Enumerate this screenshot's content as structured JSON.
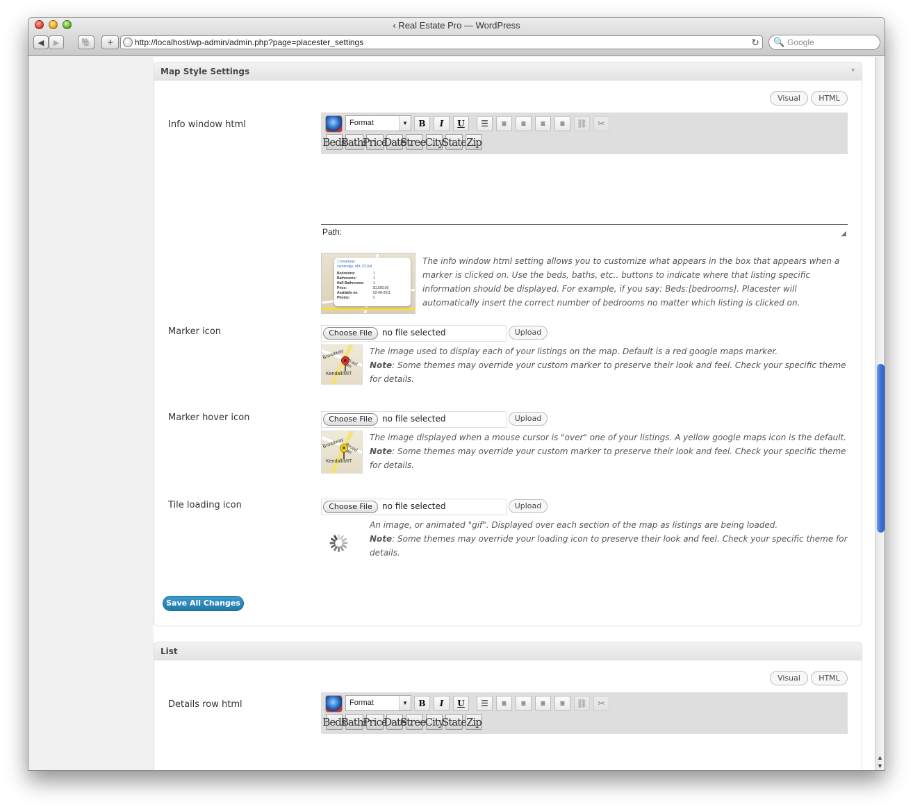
{
  "window": {
    "title": "‹ Real Estate Pro — WordPress",
    "url": "http://localhost/wp-admin/admin.php?page=placester_settings",
    "search_placeholder": "Google"
  },
  "map_style": {
    "section_title": "Map Style Settings",
    "visual_label": "Visual",
    "html_label": "HTML",
    "info_window": {
      "label": "Info window html",
      "path_label": "Path:",
      "description": "The info window html setting allows you to customize what appears in the box that appears when a marker is clicked on. Use the beds, baths, etc.. buttons to indicate where that listing specific information should be displayed. For example, if you say: Beds:[bedrooms]. Placester will automatically insert the correct number of bedrooms no matter which listing is clicked on.",
      "thumb": {
        "address1": "1 broadway",
        "address2": "cambridge, MA, 02104",
        "rows": [
          {
            "k": "Bedrooms:",
            "v": "1"
          },
          {
            "k": "Bathrooms:",
            "v": "1"
          },
          {
            "k": "Half Bathrooms:",
            "v": "1"
          },
          {
            "k": "Price:",
            "v": "$1,500.00"
          },
          {
            "k": "Available on:",
            "v": "02-08-2011"
          },
          {
            "k": "Photos:",
            "v": "0"
          }
        ]
      }
    },
    "marker_icon": {
      "label": "Marker icon",
      "choose_label": "Choose File",
      "no_file": "no file selected",
      "upload_label": "Upload",
      "description": "The image used to display each of your listings on the map. Default is a red google maps marker.",
      "note_label": "Note",
      "note_text": ": Some themes may override your custom marker to preserve their look and feel. Check your specific theme for details.",
      "pin_color": "#d9342b"
    },
    "marker_hover_icon": {
      "label": "Marker hover icon",
      "choose_label": "Choose File",
      "no_file": "no file selected",
      "upload_label": "Upload",
      "description": "The image displayed when a mouse cursor is \"over\" one of your listings. A yellow google maps icon is the default.",
      "note_label": "Note",
      "note_text": ": Some themes may override your custom marker to preserve their look and feel. Check your specific theme for details.",
      "pin_color": "#f2d21b"
    },
    "tile_loading_icon": {
      "label": "Tile loading icon",
      "choose_label": "Choose File",
      "no_file": "no file selected",
      "upload_label": "Upload",
      "description": "An image, or animated \"gif\". Displayed over each section of the map as listings are being loaded.",
      "note_label": "Note",
      "note_text": ": Some themes may override your loading icon to preserve their look and feel. Check your specific theme for details."
    },
    "save_label": "Save All Changes"
  },
  "map_labels": {
    "road": "Broad Can",
    "street": "Broadway",
    "station": "Kendall/MIT"
  },
  "toolbar": {
    "format_label": "Format",
    "bold": "B",
    "italic": "I",
    "underline": "U",
    "placeholders": [
      "Beds",
      "Baths",
      "Price",
      "Date",
      "Street",
      "City",
      "State",
      "Zip"
    ]
  },
  "list": {
    "section_title": "List",
    "visual_label": "Visual",
    "html_label": "HTML",
    "details_label": "Details row html"
  },
  "colors": {
    "accent": "#2178a8",
    "scroll_thumb": "#3c73d9"
  }
}
